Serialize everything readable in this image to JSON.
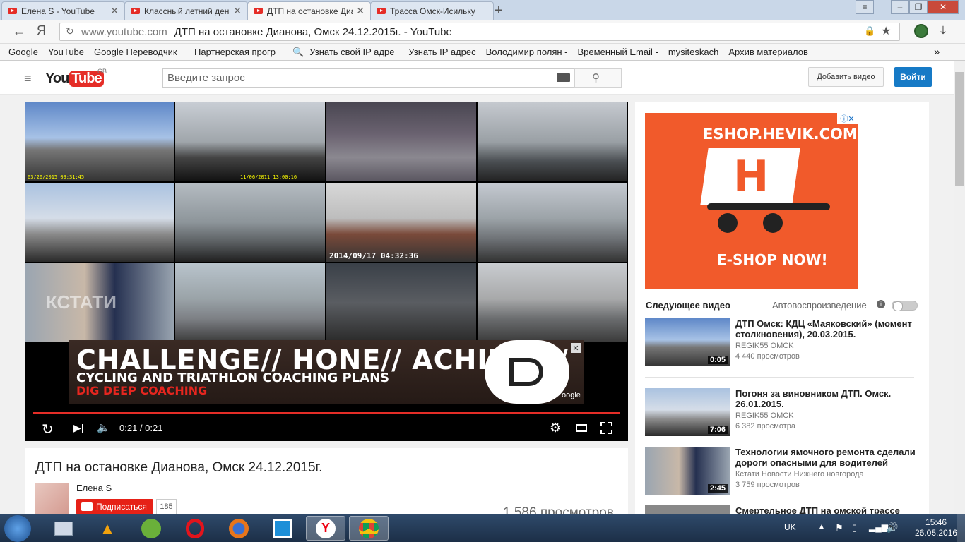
{
  "browser": {
    "tabs": [
      {
        "title": "Елена S - YouTube",
        "active": false
      },
      {
        "title": "Классный летний день",
        "active": false
      },
      {
        "title": "ДТП на остановке Диа",
        "active": true
      },
      {
        "title": "Трасса Омск-Исильку",
        "active": false
      }
    ],
    "new_tab": "+",
    "url_domain": "www.youtube.com",
    "url_title": "ДТП на остановке Дианова, Омск 24.12.2015г. - YouTube",
    "bookmarks": [
      "Google",
      "YouTube",
      "Google Переводчик",
      "Партнерская прогр",
      "Узнать свой IP адре",
      "Узнать IP адрес",
      "Володимир полян -",
      "Временный Email -",
      "mysiteskach",
      "Архив материалов"
    ],
    "more": "»"
  },
  "youtube": {
    "logo_text": "You",
    "logo_tube": "Tube",
    "region": "GB",
    "search_placeholder": "Введите запрос",
    "add_video": "Добавить видео",
    "sign_in": "Войти"
  },
  "player": {
    "stamps": [
      "03/20/2015 09:31:45",
      "11/06/2011 13:00:16",
      "2014/09/17 04:32:36",
      "КСТАТИ"
    ],
    "ad": {
      "line1": "CHALLENGE// HONE// ACHIEVE//",
      "line2": "CYCLING AND TRIATHLON COACHING PLANS",
      "line3": "DIG DEEP COACHING",
      "google": "oogle"
    },
    "time": "0:21 / 0:21",
    "progress": 1.0
  },
  "video": {
    "title": "ДТП на остановке Дианова, Омск 24.12.2015г.",
    "channel": "Елена S",
    "subscribe": "Подписаться",
    "subscribers": "185",
    "views": "1 586 просмотров"
  },
  "sidebar": {
    "ad": {
      "domain": "ESHOP.HEVIK.COM",
      "cta": "E-SHOP NOW!",
      "letter": "H"
    },
    "next_label": "Следующее видео",
    "autoplay_label": "Автовоспроизведение",
    "autoplay_on": false,
    "videos": [
      {
        "title": "ДТП Омск: КДЦ «Маяковский» (момент столкновения), 20.03.2015.",
        "channel": "REGIK55 OMCK",
        "views": "4 440 просмотров",
        "duration": "0:05"
      },
      {
        "title": "Погоня за виновником ДТП. Омск. 26.01.2015.",
        "channel": "REGIK55 OMCK",
        "views": "6 382 просмотра",
        "duration": "7:06"
      },
      {
        "title": "Технологии ямочного ремонта сделали дороги опасными для водителей",
        "channel": "Кстати Новости Нижнего новгорода",
        "views": "3 759 просмотров",
        "duration": "2:45"
      },
      {
        "title": "Смертельное ДТП на омской трассе",
        "channel": "",
        "views": "",
        "duration": ""
      }
    ]
  },
  "taskbar": {
    "lang": "UK",
    "time": "15:46",
    "date": "26.05.2016"
  },
  "colors": {
    "yt_red": "#e52d27",
    "signin_blue": "#167ac6",
    "ad_orange": "#f15a2b"
  }
}
